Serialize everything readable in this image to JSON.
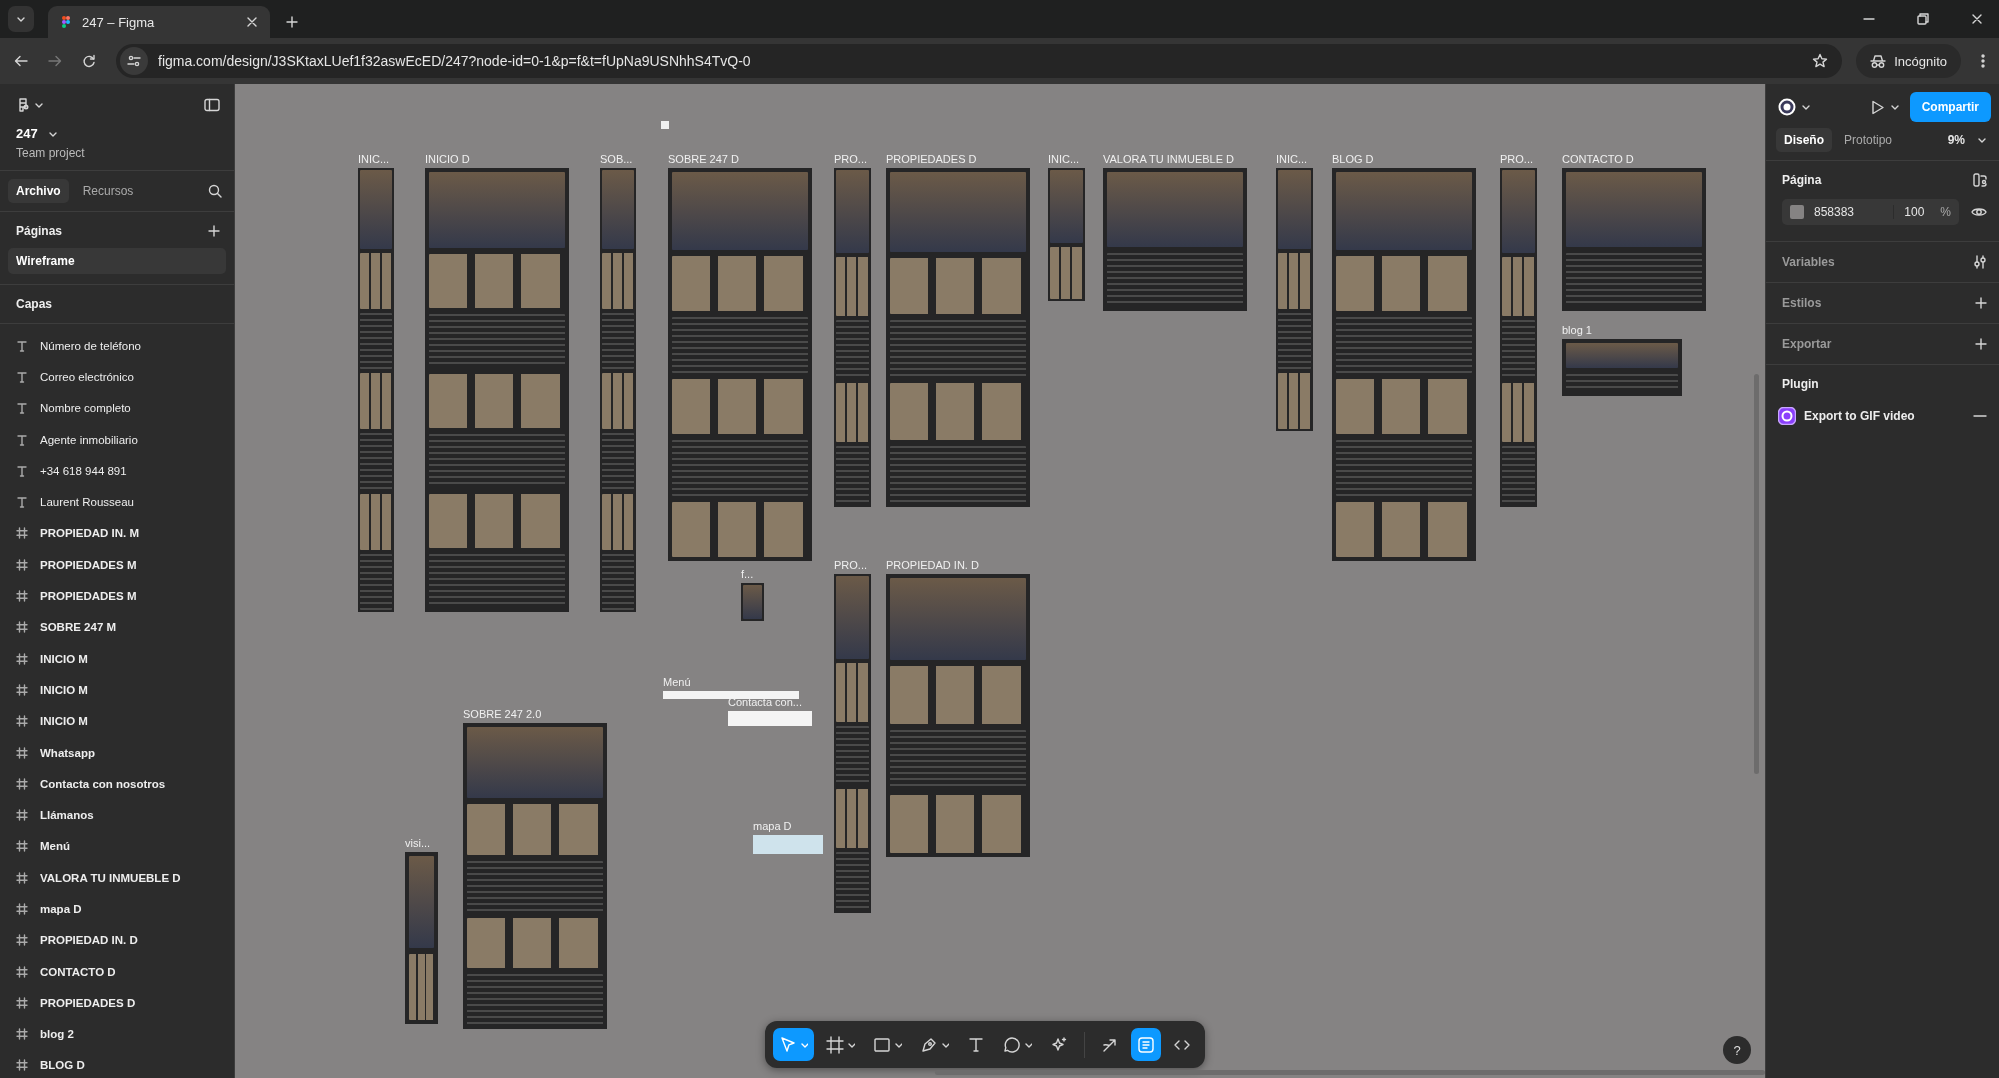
{
  "browser": {
    "tab_title": "247 – Figma",
    "url": "figma.com/design/J3SKtaxLUef1f32aswEcED/247?node-id=0-1&p=f&t=fUpNa9USNhhS4TvQ-0",
    "profile": "Incógnito"
  },
  "left_panel": {
    "file_name": "247",
    "project": "Team project",
    "tabs": [
      {
        "label": "Archivo",
        "selected": true
      },
      {
        "label": "Recursos",
        "selected": false
      }
    ],
    "pages_heading": "Páginas",
    "pages": [
      {
        "label": "Wireframe",
        "selected": true
      }
    ],
    "layers_heading": "Capas",
    "layers": [
      {
        "kind": "text",
        "name": "Número de teléfono"
      },
      {
        "kind": "text",
        "name": "Correo electrónico"
      },
      {
        "kind": "text",
        "name": "Nombre completo"
      },
      {
        "kind": "text",
        "name": "Agente inmobiliario"
      },
      {
        "kind": "text",
        "name": "+34 618 944 891"
      },
      {
        "kind": "text",
        "name": "Laurent Rousseau"
      },
      {
        "kind": "frame",
        "name": "PROPIEDAD IN. M"
      },
      {
        "kind": "frame",
        "name": "PROPIEDADES M"
      },
      {
        "kind": "frame",
        "name": "PROPIEDADES M"
      },
      {
        "kind": "frame",
        "name": "SOBRE 247 M"
      },
      {
        "kind": "frame",
        "name": "INICIO M"
      },
      {
        "kind": "frame",
        "name": "INICIO M"
      },
      {
        "kind": "frame",
        "name": "INICIO M"
      },
      {
        "kind": "frame",
        "name": "Whatsapp"
      },
      {
        "kind": "frame",
        "name": "Contacta con nosotros"
      },
      {
        "kind": "frame",
        "name": "Llámanos"
      },
      {
        "kind": "frame",
        "name": "Menú"
      },
      {
        "kind": "frame",
        "name": "VALORA TU INMUEBLE D"
      },
      {
        "kind": "frame",
        "name": "mapa D"
      },
      {
        "kind": "frame",
        "name": "PROPIEDAD IN. D"
      },
      {
        "kind": "frame",
        "name": "CONTACTO D"
      },
      {
        "kind": "frame",
        "name": "PROPIEDADES D"
      },
      {
        "kind": "frame",
        "name": "blog 2"
      },
      {
        "kind": "frame",
        "name": "BLOG D"
      }
    ]
  },
  "canvas": {
    "frames": [
      {
        "label": "INIC..."
      },
      {
        "label": "INICIO D"
      },
      {
        "label": "SOB..."
      },
      {
        "label": "SOBRE 247 D"
      },
      {
        "label": "PRO..."
      },
      {
        "label": "PROPIEDADES D"
      },
      {
        "label": "INIC..."
      },
      {
        "label": "VALORA TU INMUEBLE D"
      },
      {
        "label": "INIC..."
      },
      {
        "label": "BLOG D"
      },
      {
        "label": "PRO..."
      },
      {
        "label": "CONTACTO D"
      },
      {
        "label": "blog 1"
      },
      {
        "label": "f..."
      },
      {
        "label": "Menú"
      },
      {
        "label": "Contacta con..."
      },
      {
        "label": "PRO..."
      },
      {
        "label": "PROPIEDAD IN. D"
      },
      {
        "label": "mapa D"
      },
      {
        "label": "SOBRE 247 2.0"
      },
      {
        "label": "visi..."
      }
    ],
    "toolbar": [
      {
        "kind": "move",
        "selected": true
      },
      {
        "kind": "frame",
        "selected": false
      },
      {
        "kind": "rectangle",
        "selected": false
      },
      {
        "kind": "pen",
        "selected": false
      },
      {
        "kind": "text",
        "selected": false
      },
      {
        "kind": "comment",
        "selected": false
      },
      {
        "kind": "actions",
        "selected": false
      },
      {
        "kind": "draw",
        "selected": false
      },
      {
        "kind": "design",
        "selected": true
      },
      {
        "kind": "dev",
        "selected": false
      }
    ],
    "help": "?"
  },
  "right_panel": {
    "share": "Compartir",
    "tabs": [
      {
        "label": "Diseño",
        "selected": true
      },
      {
        "label": "Prototipo",
        "selected": false
      }
    ],
    "zoom": "9%",
    "page_heading": "Página",
    "page_fill": "858383",
    "page_opacity": "100",
    "percent_sign": "%",
    "sections": [
      {
        "kind": "variables",
        "label": "Variables"
      },
      {
        "kind": "add",
        "label": "Estilos"
      },
      {
        "kind": "add",
        "label": "Exportar"
      }
    ],
    "plugin_heading": "Plugin",
    "plugin": "Export to GIF video"
  }
}
